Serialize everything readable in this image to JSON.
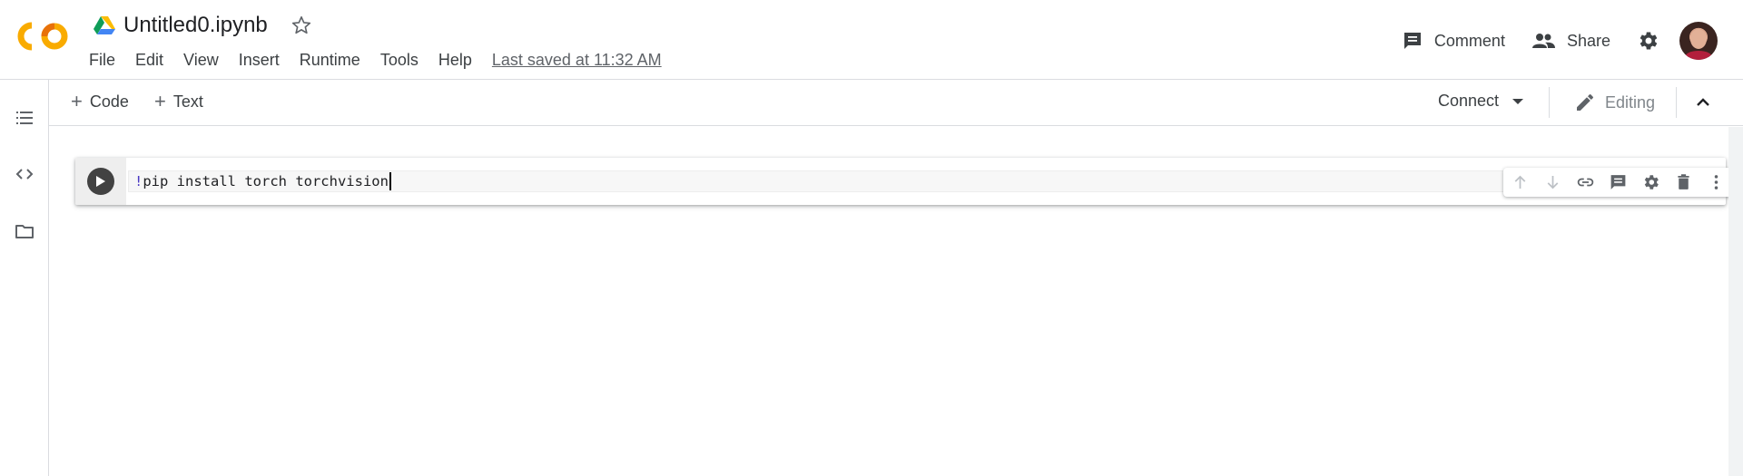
{
  "header": {
    "title": "Untitled0.ipynb",
    "menu": [
      "File",
      "Edit",
      "View",
      "Insert",
      "Runtime",
      "Tools",
      "Help"
    ],
    "last_saved": "Last saved at 11:32 AM",
    "comment_label": "Comment",
    "share_label": "Share",
    "icons": {
      "logo": "colab-logo",
      "drive": "google-drive-icon",
      "star": "star-icon",
      "comment": "comment-icon",
      "share": "people-icon",
      "settings": "gear-icon",
      "avatar": "user-avatar"
    }
  },
  "sidebar": {
    "items": [
      "table-of-contents-icon",
      "code-snippets-icon",
      "files-folder-icon"
    ]
  },
  "toolbar": {
    "add_code_label": "Code",
    "add_text_label": "Text",
    "connect_label": "Connect",
    "editing_label": "Editing"
  },
  "cell": {
    "code_prefix": "!",
    "code_rest": "pip install torch torchvision",
    "actions": [
      "move-up-icon",
      "move-down-icon",
      "link-icon",
      "comment-icon",
      "gear-icon",
      "delete-icon",
      "more-vert-icon"
    ]
  },
  "colors": {
    "logo_orange": "#F9AB00",
    "logo_dark_orange": "#E8710A",
    "text_primary": "#202124",
    "text_secondary": "#5f6368",
    "code_magic": "#4a39c4",
    "run_button": "#424242"
  }
}
